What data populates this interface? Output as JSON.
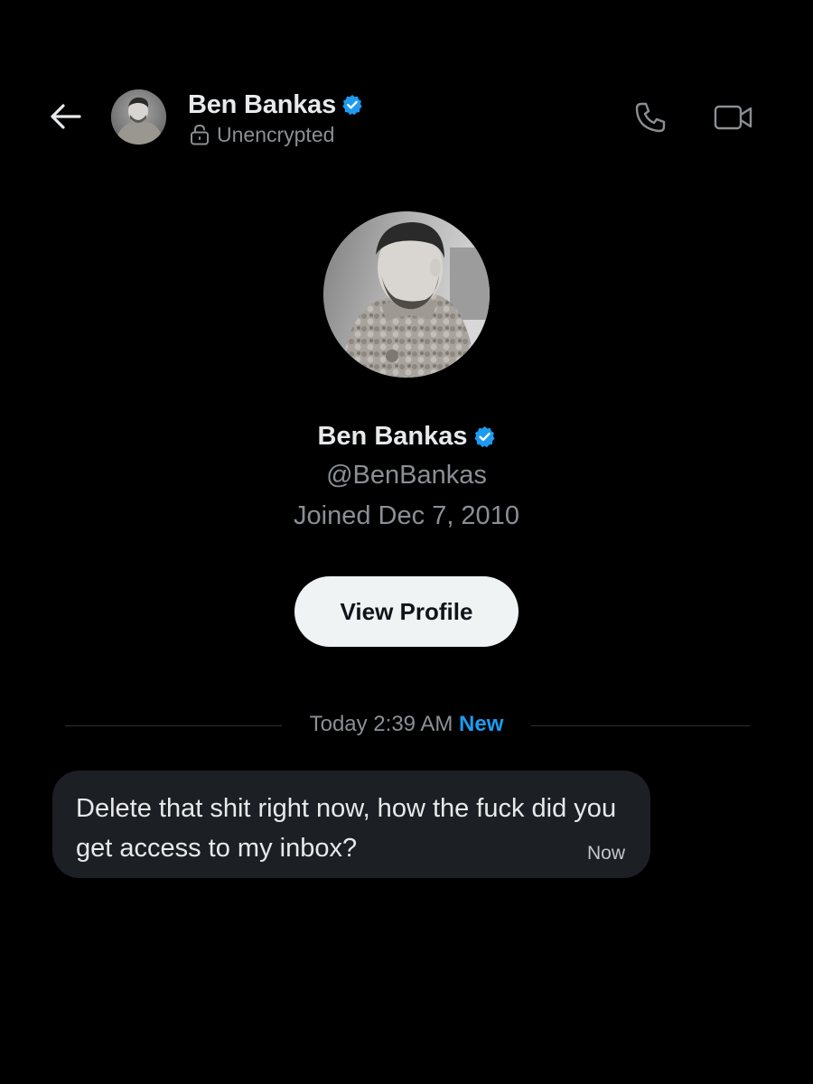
{
  "header": {
    "name": "Ben Bankas",
    "encryption_status": "Unencrypted",
    "icons": {
      "back": "arrow-left-icon",
      "lock": "lock-open-icon",
      "verified": "verified-badge-icon",
      "call": "phone-icon",
      "video": "video-camera-icon"
    }
  },
  "profile": {
    "name": "Ben Bankas",
    "handle": "@BenBankas",
    "joined": "Joined Dec 7, 2010",
    "view_profile_label": "View Profile"
  },
  "conversation": {
    "divider_time": "Today 2:39 AM",
    "divider_new": "New",
    "messages": [
      {
        "text": "Delete that shit right now, how the fuck did you get access to my inbox?",
        "time": "Now"
      }
    ]
  },
  "colors": {
    "background": "#000000",
    "accent": "#1d9bf0",
    "bubble": "#1c1f23",
    "secondary_text": "#8b8f94",
    "button_bg": "#eff3f4"
  }
}
